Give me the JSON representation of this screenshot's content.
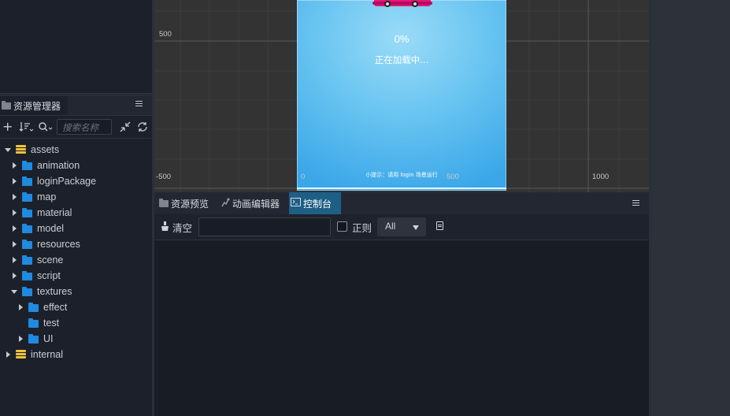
{
  "assets_panel": {
    "tab_label": "资源管理器",
    "search_placeholder": "搜索名称",
    "tree": [
      {
        "label": "assets",
        "kind": "db",
        "expanded": true,
        "depth": 0
      },
      {
        "label": "animation",
        "kind": "folder",
        "expanded": false,
        "depth": 1
      },
      {
        "label": "loginPackage",
        "kind": "folder",
        "expanded": false,
        "depth": 1
      },
      {
        "label": "map",
        "kind": "folder",
        "expanded": false,
        "depth": 1
      },
      {
        "label": "material",
        "kind": "folder",
        "expanded": false,
        "depth": 1
      },
      {
        "label": "model",
        "kind": "folder",
        "expanded": false,
        "depth": 1
      },
      {
        "label": "resources",
        "kind": "folder",
        "expanded": false,
        "depth": 1
      },
      {
        "label": "scene",
        "kind": "folder",
        "expanded": false,
        "depth": 1
      },
      {
        "label": "script",
        "kind": "folder",
        "expanded": false,
        "depth": 1
      },
      {
        "label": "textures",
        "kind": "folder",
        "expanded": true,
        "depth": 1
      },
      {
        "label": "effect",
        "kind": "folder",
        "expanded": false,
        "depth": 2
      },
      {
        "label": "test",
        "kind": "folder",
        "expanded": null,
        "depth": 2
      },
      {
        "label": "UI",
        "kind": "folder",
        "expanded": false,
        "depth": 2
      },
      {
        "label": "internal",
        "kind": "db",
        "expanded": false,
        "depth": 0
      }
    ]
  },
  "scene": {
    "ruler_left_top": "500",
    "ruler_left_bottom": "-500",
    "ruler_bottom_zero": "0",
    "ruler_bottom_mid": "500",
    "ruler_bottom_right": "1000",
    "loading_percent": "0%",
    "loading_text": "正在加载中...",
    "footer_text": "小提示：请用 login 场景运行",
    "colors": {
      "grid_bg": "#333333",
      "canvas_light": "#8fd6f5",
      "canvas_dark": "#3aa9e8"
    }
  },
  "console": {
    "tabs": [
      {
        "label": "资源预览",
        "icon": "folder-icon"
      },
      {
        "label": "动画编辑器",
        "icon": "animation-icon"
      },
      {
        "label": "控制台",
        "icon": "console-icon",
        "selected": true
      }
    ],
    "clear_label": "清空",
    "filter_value": "",
    "regex_label": "正则",
    "level_value": "All"
  }
}
